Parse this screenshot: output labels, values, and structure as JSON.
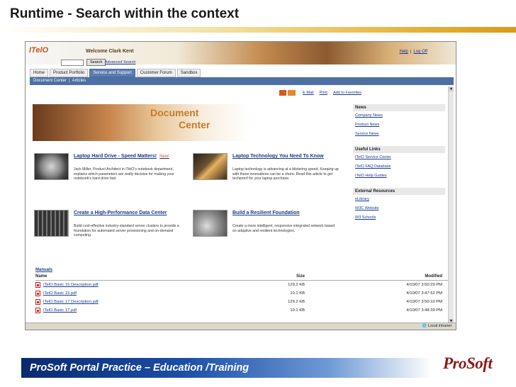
{
  "slide": {
    "title": "Runtime - Search within the context",
    "footer": "ProSoft Portal Practice – Education /Training",
    "logo": "ProSoft"
  },
  "portal": {
    "logo": "ITelO",
    "welcome": "Welcome Clark Kent",
    "help": "Help",
    "logoff": "Log Off",
    "search_button": "Search",
    "advanced_search": "Advanced Search",
    "tabs": [
      "Home",
      "Product Portfolio",
      "Service and Support",
      "Customer Forum",
      "Sandbox"
    ],
    "active_tab": 2,
    "breadcrumb": [
      "Document Center",
      "Articles"
    ],
    "toolbar": {
      "btn1": "",
      "btn2": "",
      "email": "E-Mail",
      "print": "Print",
      "favorites": "Add to Favorites"
    },
    "banner": {
      "line1": "Document",
      "line2": "Center"
    },
    "articles": [
      {
        "title": "Laptop Hard Drive - Speed Matters!",
        "badge": "New!",
        "body": "Jack Miller, Product Architect in ITelO's notebook department, explains which parameters are really decisive for making your notebook's hard drive fast."
      },
      {
        "title": "Laptop Technology You Need To Know",
        "badge": "",
        "body": "Laptop technology is advancing at a blistering speed. Keeping up with these innovations can be a chore. Read this article to get techproof for your laptop purchase."
      },
      {
        "title": "Create a High-Performance Data Center",
        "badge": "",
        "body": "Build cost-effective industry-standard server clusters to provide a foundation for automated server provisioning and on-demand computing."
      },
      {
        "title": "Build a Resilient Foundation",
        "badge": "",
        "body": "Create a more intelligent, responsive integrated network based on adaptive and resilient technologies."
      }
    ],
    "sidebar": {
      "news": {
        "heading": "News",
        "links": [
          "Company News",
          "Product News",
          "Service News"
        ]
      },
      "useful": {
        "heading": "Useful Links",
        "links": [
          "ITelO Service Center",
          "ITelO FAQ Database",
          "ITelO Help Guides"
        ]
      },
      "external": {
        "heading": "External Resources",
        "links": [
          "eLibrary",
          "W3C Website",
          "W3 Schools"
        ]
      }
    },
    "manuals": {
      "heading": "Manuals",
      "columns": [
        "Name",
        "Size",
        "Modified"
      ],
      "rows": [
        {
          "name": "ITelO Basic 15 Description.pdf",
          "size": "129.2 KB",
          "modified": "4/10/07 3:50:29 PM"
        },
        {
          "name": "ITelO Basic 15.pdf",
          "size": "10.1 KB",
          "modified": "4/10/07 3:47:52 PM"
        },
        {
          "name": "ITelO Basic 17 Description.pdf",
          "size": "129.2 KB",
          "modified": "4/10/07 3:50:10 PM"
        },
        {
          "name": "ITelO Basic 17.pdf",
          "size": "10.1 KB",
          "modified": "4/10/07 3:48:39 PM"
        }
      ]
    },
    "status_zone": "Local intranet"
  }
}
